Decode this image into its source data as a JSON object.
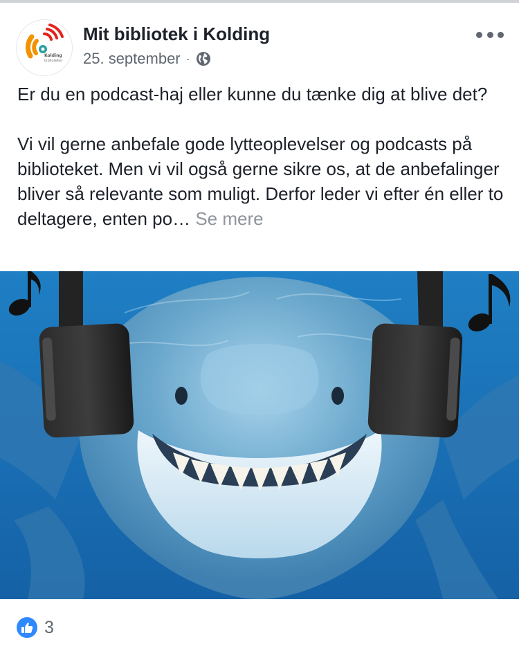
{
  "post": {
    "page_name": "Mit bibliotek i Kolding",
    "date": "25. september",
    "separator": "·",
    "logo_text": "Kolding bibliotekerne",
    "paragraph1": "Er du en podcast-haj eller kunne du tænke dig at blive det?",
    "paragraph2": "Vi vil gerne anbefale gode lytteoplevelser og podcasts på biblioteket. Men vi vil også gerne sikre os, at de anbefalinger bliver så relevante som muligt. Derfor leder vi efter én eller to deltagere, enten po…",
    "see_more": "Se mere",
    "image_alt": "Haj med hovedtelefoner og musiknoder"
  },
  "reactions": {
    "count": "3",
    "type_icon": "like-icon"
  },
  "icons": {
    "privacy": "globe-icon",
    "menu": "more-options-icon",
    "note": "music-note-icon"
  },
  "colors": {
    "name_text": "#1d2129",
    "meta_text": "#616770",
    "see_more": "#90949c",
    "like_blue": "#2e89ff",
    "water": "#1b6fb3",
    "logo_orange": "#f39200",
    "logo_red": "#e2231a",
    "logo_teal": "#2a9fa0"
  }
}
